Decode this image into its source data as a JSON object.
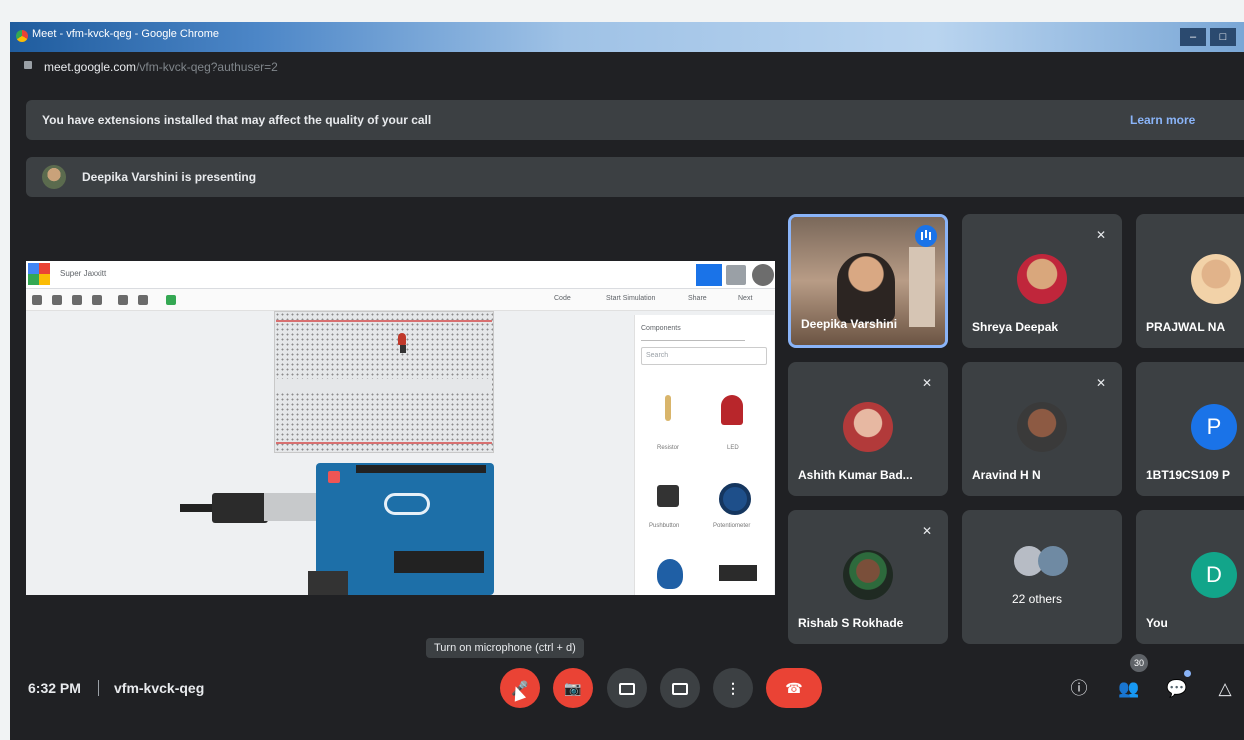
{
  "browser": {
    "window_title": "Meet - vfm-kvck-qeg - Google Chrome",
    "url_host": "meet.google.com",
    "url_path": "/vfm-kvck-qeg?authuser=2"
  },
  "banners": {
    "extensions_text": "You have extensions installed that may affect the quality of your call",
    "learn_more": "Learn more",
    "presenting_text": "Deepika Varshini is presenting"
  },
  "presentation": {
    "doc_title": "Super Jaxxitt",
    "toolbar_code": "Code",
    "toolbar_simulate": "Start Simulation",
    "toolbar_share": "Share",
    "toolbar_more": "Next",
    "panel_select": "Components",
    "panel_search": "Search",
    "components": [
      "Resistor",
      "LED",
      "Pushbutton",
      "Potentiometer"
    ]
  },
  "participants": [
    {
      "name": "Deepika Varshini",
      "type": "video",
      "speaking": true
    },
    {
      "name": "Shreya Deepak",
      "type": "photo",
      "muted": true
    },
    {
      "name": "PRAJWAL NA",
      "type": "photo",
      "muted": false
    },
    {
      "name": "Ashith Kumar Bad...",
      "type": "photo",
      "muted": true
    },
    {
      "name": "Aravind H N",
      "type": "photo",
      "muted": true
    },
    {
      "name": "1BT19CS109 P",
      "type": "letter",
      "letter": "P",
      "color": "#1a73e8"
    },
    {
      "name": "Rishab S Rokhade",
      "type": "photo",
      "muted": true
    },
    {
      "name": "22 others",
      "type": "group"
    },
    {
      "name": "You",
      "type": "letter",
      "letter": "D",
      "color": "#12a58a"
    }
  ],
  "tooltip": "Turn on microphone (ctrl + d)",
  "bottom_bar": {
    "time": "6:32 PM",
    "meeting_code": "vfm-kvck-qeg",
    "participants_count": "30"
  },
  "colors": {
    "background": "#202124",
    "tile": "#3c4043",
    "accent_blue": "#8ab4f8",
    "danger_red": "#ea4335"
  }
}
